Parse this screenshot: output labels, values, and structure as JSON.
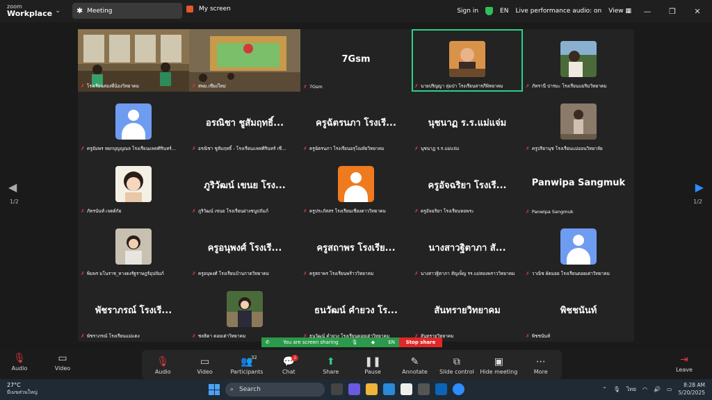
{
  "app": {
    "logo_line1": "zoom",
    "logo_line2": "Workplace",
    "chevron": "⌄"
  },
  "tabs": {
    "meeting": "Meeting",
    "my_screen": "My screen"
  },
  "topbar": {
    "sign_in": "Sign in",
    "lang": "EN",
    "audio_status": "Live performance audio: on",
    "view": "View"
  },
  "tiles": [
    {
      "label": "โรงเรียนสองพี่น้องวิทยาคม",
      "type": "video"
    },
    {
      "label": "สพม.เชียงใหม่",
      "type": "video"
    },
    {
      "big": "7Gsm",
      "label": "7Gsm",
      "type": "name"
    },
    {
      "label": "นายปริญญา ลุ่มป่า โรงเรียนสารภีพิทยาคม",
      "type": "photo",
      "active": true
    },
    {
      "label": "ภัทรานี ปารมะ โรงเรียนแม่ริมวิทยาคม",
      "type": "photo"
    },
    {
      "label": "ครูอัมพร หยกบุญญณล โรงเรียนแพทศิรินทร์...",
      "type": "avatar-blue"
    },
    {
      "big": "อรณิชา ชูสัมฤทธิ์...",
      "label": "อรณิชา ชูสัมฤทธิ์ - โรงเรียนแพทศิรินทร์ เชี...",
      "type": "name"
    },
    {
      "big": "ครูฉัตรนภา โรงเรี...",
      "label": "ครูฉัตรนภา โรงเรียนอรุโณทัยวิทยาคม",
      "type": "name"
    },
    {
      "big": "นุชนาฏ ร.ร.แม่แจ่ม",
      "label": "นุชนาฏ ร.ร.แม่แจ่ม",
      "type": "name"
    },
    {
      "label": "ครูปริยานุช โรงเรียนแม่ออนวิทยาลัย",
      "type": "photo"
    },
    {
      "label": "ภัทรนันท์ เจตต์กัย",
      "type": "photo"
    },
    {
      "big": "ภูริวัฒน์ เขนย โรง...",
      "label": "ภูริวัฒน์ เขนย โรงเรียนฝางชนูปถัมภ์",
      "type": "name"
    },
    {
      "label": "ครูประภัสสร โรงเรียนเชียงดาววิทยาคม",
      "type": "avatar-orange"
    },
    {
      "big": "ครูอัจฉริยา โรงเรี...",
      "label": "ครูอัจฉริยา โรงเรียนหอพระ",
      "type": "name"
    },
    {
      "big": "Panwipa Sangmuk",
      "label": "Panwipa Sangmuk",
      "type": "name"
    },
    {
      "label": "พิมพร มโนราช_หางดงรัฐราษฎร์อุปถัมภ์",
      "type": "photo"
    },
    {
      "big": "ครูอนุพงศ์  โรงเรี...",
      "label": "ครูอนุพงศ์  โรงเรียนบ้านกาดวิทยาคม",
      "type": "name"
    },
    {
      "big": "ครูสถาพร โรงเรีย...",
      "label": "ครูสถาพร โรงเรียนพร้าววิทยาคม",
      "type": "name"
    },
    {
      "big": "นางสาวฐิตาภา สั...",
      "label": "นางสาวฐิตาภา สัญเพ็ญ รร.แม่ทองพราววิทยาคม",
      "type": "name"
    },
    {
      "label": "วาณิช ผัดมอย โรงเรียนดอยเต่าวิทยาคม",
      "type": "avatar-blue"
    },
    {
      "big": "พัชราภรณ์ โรงเรี...",
      "label": "พัชราภรณ์ โรงเรียนแม่แตง",
      "type": "name"
    },
    {
      "label": "ชลธิดา ดอยเต่าวิทยาคม",
      "type": "photo"
    },
    {
      "big": "ธนวัฒน์ คำยวง โร...",
      "label": "ธนวัฒน์ คำยวง โรงเรียนดอยเต่าวิทยาคม",
      "type": "name"
    },
    {
      "big": "สันทรายวิทยาคม",
      "label": "สันทรายวิทยาคม",
      "type": "name"
    },
    {
      "big": "พิชชนันท์",
      "label": "พิชชนันท์",
      "type": "name"
    }
  ],
  "pager": {
    "left": "1/2",
    "right": "1/2"
  },
  "sharing": {
    "text": "You are screen sharing",
    "lang": "EN",
    "stop": "Stop share"
  },
  "toolbar": {
    "audio": "Audio",
    "video": "Video",
    "participants": "Participants",
    "participants_count": "32",
    "chat": "Chat",
    "chat_badge": "2",
    "share": "Share",
    "pause": "Pause",
    "annotate": "Annotate",
    "slide_control": "Slide control",
    "hide_meeting": "Hide meeting",
    "more": "More",
    "leave": "Leave"
  },
  "taskbar": {
    "temp": "27°C",
    "weather_text": "มีเมฆส่วนใหญ่",
    "weather_badge": "1",
    "search": "Search",
    "lang": "ไทย",
    "time": "8:28 AM",
    "date": "5/20/2025"
  }
}
